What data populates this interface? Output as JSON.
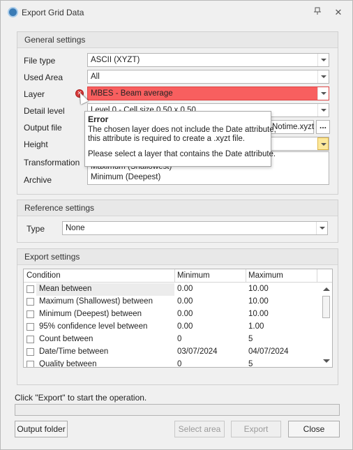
{
  "window": {
    "title": "Export Grid Data",
    "pin_icon": "pin-icon",
    "close_icon": "close-icon"
  },
  "general": {
    "header": "General settings",
    "file_type": {
      "label": "File type",
      "value": "ASCII (XYZT)"
    },
    "used_area": {
      "label": "Used Area",
      "value": "All"
    },
    "layer": {
      "label": "Layer",
      "value": "MBES - Beam average"
    },
    "detail_level": {
      "label": "Detail level",
      "value": "Level 0 - Cell size 0.50 x 0.50"
    },
    "output_file": {
      "label": "Output file",
      "value": "Notime.xyzt",
      "browse": "..."
    },
    "height": {
      "label": "Height",
      "options": [
        "Maximum (Shallowest)",
        "Minimum (Deepest)"
      ]
    },
    "transformation": {
      "label": "Transformation"
    },
    "archive": {
      "label": "Archive"
    }
  },
  "tooltip": {
    "title": "Error",
    "line1": "The chosen layer does not include the Date attribute,",
    "line2": "this attribute is required to create a .xyzt file.",
    "line3": "Please select a layer that contains the Date attribute."
  },
  "reference": {
    "header": "Reference settings",
    "type_label": "Type",
    "type_value": "None"
  },
  "export": {
    "header": "Export settings",
    "columns": [
      "Condition",
      "Minimum",
      "Maximum"
    ],
    "rows": [
      {
        "condition": "Mean between",
        "min": "0.00",
        "max": "10.00"
      },
      {
        "condition": "Maximum (Shallowest) between",
        "min": "0.00",
        "max": "10.00"
      },
      {
        "condition": "Minimum (Deepest) between",
        "min": "0.00",
        "max": "10.00"
      },
      {
        "condition": "95% confidence level between",
        "min": "0.00",
        "max": "1.00"
      },
      {
        "condition": "Count between",
        "min": "0",
        "max": "5"
      },
      {
        "condition": "Date/Time between",
        "min": "03/07/2024",
        "max": "04/07/2024"
      },
      {
        "condition": "Quality between",
        "min": "0",
        "max": "5"
      }
    ]
  },
  "status_text": "Click \"Export\" to start the operation.",
  "buttons": {
    "output_folder": "Output folder",
    "select_area": "Select area",
    "export": "Export",
    "close": "Close"
  }
}
